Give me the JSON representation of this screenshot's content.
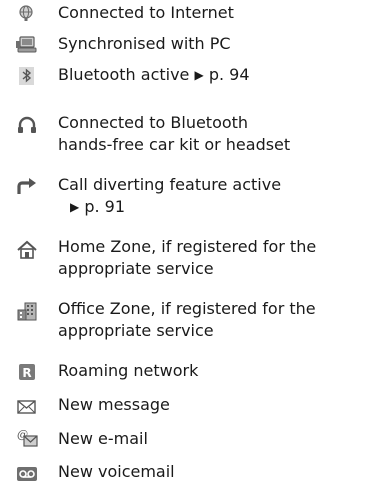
{
  "items": [
    {
      "icon": "internet-globe-icon",
      "text": "Connected to Internet"
    },
    {
      "icon": "pc-sync-icon",
      "text": "Synchronised with PC"
    },
    {
      "icon": "bluetooth-icon",
      "text": "Bluetooth active",
      "ref_arrow": "▶",
      "ref": "p. 94"
    },
    {
      "icon": "headset-icon",
      "lines": [
        "Connected to Bluetooth",
        "hands-free car kit or headset"
      ]
    },
    {
      "icon": "call-divert-icon",
      "lines": [
        "Call diverting feature active"
      ],
      "ref_arrow": "▶",
      "ref": "p. 91"
    },
    {
      "icon": "home-zone-icon",
      "lines": [
        "Home Zone, if registered for the",
        "appropriate service"
      ]
    },
    {
      "icon": "office-zone-icon",
      "lines": [
        "Office Zone, if registered for the",
        "appropriate service"
      ]
    },
    {
      "icon": "roaming-icon",
      "text": "Roaming network"
    },
    {
      "icon": "envelope-icon",
      "text": "New message"
    },
    {
      "icon": "email-icon",
      "text": "New e-mail"
    },
    {
      "icon": "voicemail-icon",
      "text": "New voicemail"
    }
  ]
}
